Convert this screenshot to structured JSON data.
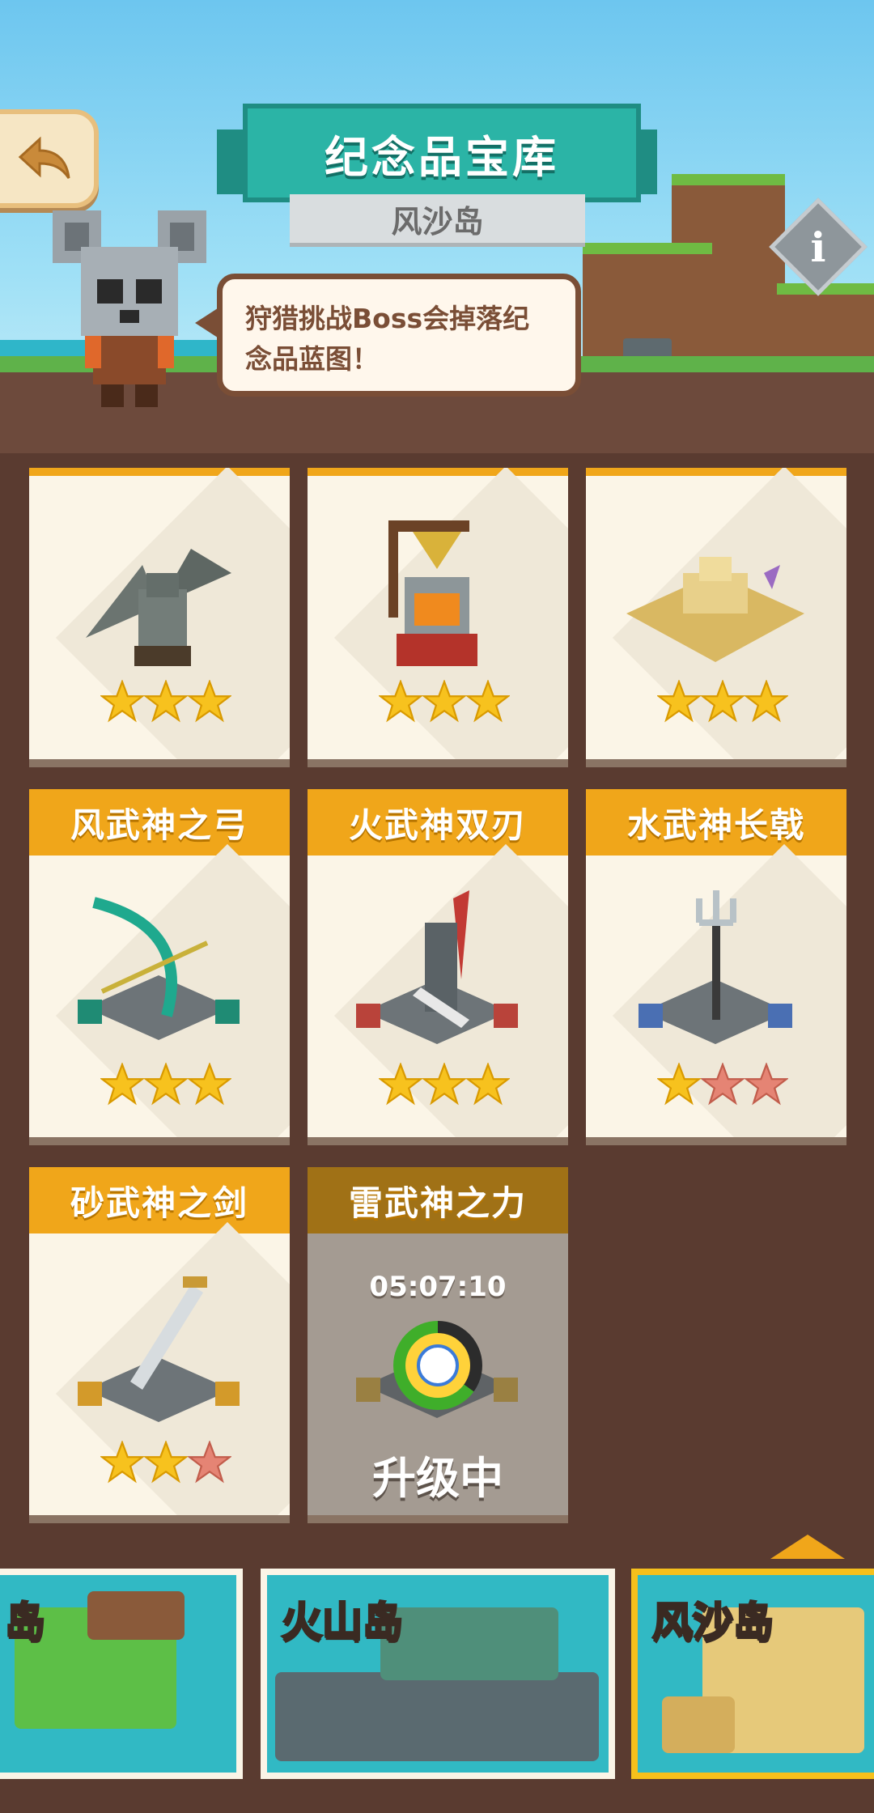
{
  "header": {
    "title": "纪念品宝库",
    "subtitle": "风沙岛",
    "hint": "狩猎挑战Boss会掉落纪念品蓝图！"
  },
  "colors": {
    "card_header": "#f0a61a",
    "ribbon": "#2bb4a6",
    "background": "#5a3b30",
    "star_gold": "#f7c21e",
    "star_empty": "#e58474"
  },
  "souvenirs": [
    {
      "name": "",
      "stars": 3,
      "max_stars": 3,
      "icon": "gargoyle-statue-icon"
    },
    {
      "name": "",
      "stars": 3,
      "max_stars": 3,
      "icon": "pumpkin-knight-totem-icon"
    },
    {
      "name": "",
      "stars": 3,
      "max_stars": 3,
      "icon": "sand-castle-icon"
    },
    {
      "name": "风武神之弓",
      "stars": 3,
      "max_stars": 3,
      "icon": "wind-bow-icon"
    },
    {
      "name": "火武神双刃",
      "stars": 3,
      "max_stars": 3,
      "icon": "fire-blades-icon"
    },
    {
      "name": "水武神长戟",
      "stars": 1,
      "max_stars": 3,
      "icon": "trident-icon"
    },
    {
      "name": "砂武神之剑",
      "stars": 2,
      "max_stars": 3,
      "icon": "sand-sword-icon"
    },
    {
      "name": "雷武神之力",
      "timer": "05:07:10",
      "status": "升级中",
      "icon": "thunder-power-icon"
    }
  ],
  "islands": [
    {
      "label": "岛",
      "selected": false
    },
    {
      "label": "火山岛",
      "selected": false
    },
    {
      "label": "风沙岛",
      "selected": true
    }
  ]
}
